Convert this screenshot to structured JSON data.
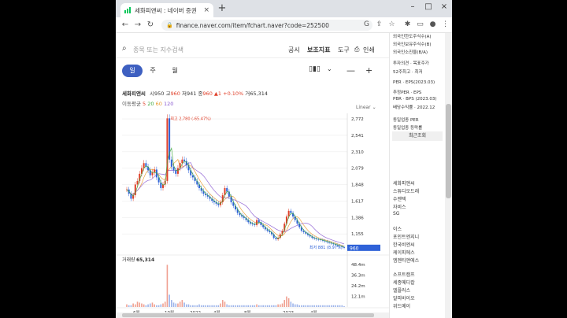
{
  "browser": {
    "tab_title": "세화피앤씨 : 네이버 증권",
    "url": "finance.naver.com/item/fchart.naver?code=252500"
  },
  "page": {
    "search_placeholder": "종목 또는 지수검색",
    "nav": [
      "공시",
      "보조지표",
      "도구",
      "인쇄"
    ],
    "periods": [
      "일",
      "주",
      "월"
    ],
    "quote": {
      "name": "세화피앤씨",
      "open_label": "시",
      "open": "950",
      "high_label": "고",
      "high": "960",
      "low_label": "저",
      "low": "941",
      "close_label": "종",
      "close": "960",
      "change": "▲1 +0.10%",
      "volume_label": "거",
      "volume": "65,314"
    },
    "ma": {
      "label": "이동평균",
      "values": [
        "5",
        "20",
        "60",
        "120"
      ],
      "colors": [
        "#e0402a",
        "#3ca83c",
        "#e89a2a",
        "#8a5ad0"
      ]
    },
    "scale_label": "Linear",
    "volume_title": "거래량",
    "volume_value": "65,314"
  },
  "chart_data": {
    "type": "candlestick-line",
    "y_ticks": [
      "2,772",
      "2,541",
      "2,310",
      "2,079",
      "1,848",
      "1,617",
      "1,386",
      "1,155"
    ],
    "ylim": [
      925,
      2850
    ],
    "x_ticks": [
      "6월",
      "10월",
      "2022",
      "4월",
      "8월",
      "2023",
      "4월"
    ],
    "max_label": "최고 2,780 (-65.47%)",
    "min_label": "최저 881 (8.97%)",
    "current_price": "960",
    "volume_ticks": [
      "48.4m",
      "36.3m",
      "24.2m",
      "12.1m"
    ],
    "close_series": [
      1780,
      1720,
      1650,
      1700,
      1850,
      1900,
      2000,
      2080,
      2150,
      2100,
      2050,
      1980,
      2020,
      2060,
      1950,
      1880,
      1800,
      1850,
      1900,
      2780,
      2200,
      2100,
      2050,
      2000,
      2080,
      2150,
      2200,
      2180,
      2120,
      2050,
      1980,
      1950,
      1900,
      1850,
      1800,
      1760,
      1720,
      1700,
      1680,
      1650,
      1620,
      1600,
      1580,
      1560,
      1600,
      1700,
      1800,
      1750,
      1680,
      1600,
      1550,
      1500,
      1450,
      1420,
      1400,
      1380,
      1350,
      1320,
      1300,
      1290,
      1280,
      1350,
      1320,
      1280,
      1250,
      1220,
      1200,
      1180,
      1150,
      1100,
      1080,
      1100,
      1150,
      1200,
      1300,
      1400,
      1480,
      1450,
      1400,
      1350,
      1300,
      1250,
      1200,
      1180,
      1160,
      1140,
      1120,
      1100,
      1090,
      1080,
      1075,
      1070,
      1060,
      1050,
      1040,
      1030,
      1020,
      1010,
      1000,
      990,
      980,
      970,
      960
    ],
    "volume_series": [
      3,
      2,
      2,
      4,
      3,
      6,
      5,
      4,
      3,
      2,
      3,
      4,
      5,
      3,
      2,
      2,
      3,
      4,
      6,
      48,
      14,
      8,
      5,
      4,
      4,
      6,
      8,
      5,
      3,
      3,
      2,
      2,
      2,
      2,
      3,
      2,
      2,
      2,
      2,
      2,
      2,
      2,
      2,
      2,
      4,
      8,
      6,
      3,
      2,
      2,
      2,
      2,
      2,
      2,
      2,
      2,
      2,
      2,
      2,
      2,
      2,
      3,
      2,
      2,
      2,
      2,
      2,
      2,
      2,
      2,
      2,
      3,
      3,
      4,
      8,
      12,
      10,
      6,
      4,
      3,
      3,
      2,
      2,
      2,
      2,
      2,
      2,
      2,
      2,
      2,
      2,
      2,
      2,
      2,
      2,
      2,
      2,
      2,
      2,
      2,
      2,
      2,
      1
    ]
  },
  "side": {
    "lines": [
      "외국인한도주식수(A)",
      "외국인보유주식수(B)",
      "외국인소진율(B/A)",
      "투자의견 · 목표주가",
      "52주최고 · 최저",
      "PER · EPS(2023.03)",
      "추정PER · EPS",
      "PBR · BPS (2023.03)",
      "배당수익률 · 2022.12",
      "동일업종 PER",
      "동일업종 등락률"
    ],
    "recent_title": "최근조회",
    "recent": [
      "세화피앤씨",
      "스튜디오드래",
      "수젠텍",
      "자비스",
      "SG",
      "이스",
      "포인트엔지니",
      "한국비엔씨",
      "케이피에스",
      "엠젠티앤에스",
      "소프트캠프",
      "세종메디칼",
      "엘플러스",
      "알피바이오",
      "위드메이"
    ]
  }
}
